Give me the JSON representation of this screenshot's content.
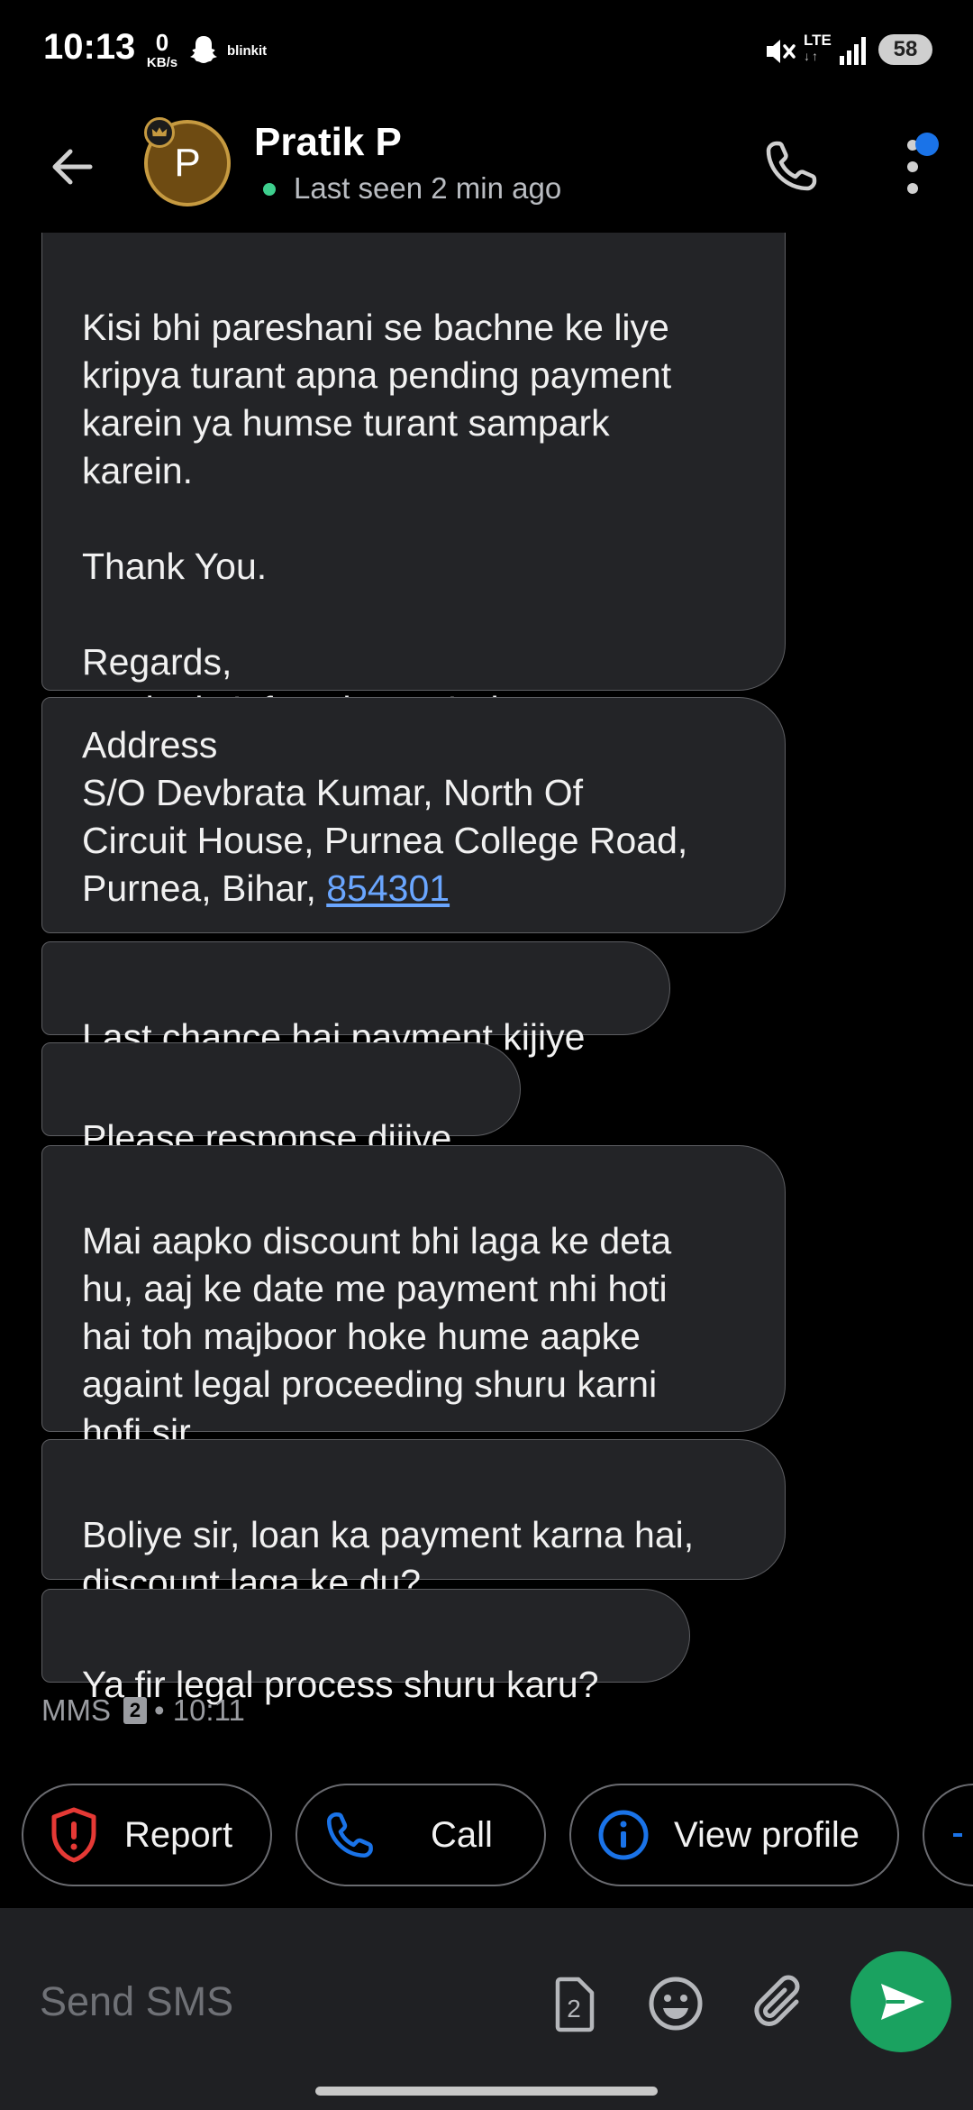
{
  "status_bar": {
    "time": "10:13",
    "net_speed_value": "0",
    "net_speed_unit": "KB/s",
    "notification_app": "blinkit",
    "network": "LTE",
    "battery": "58"
  },
  "header": {
    "avatar_initial": "P",
    "contact_name": "Pratik P",
    "presence": "Last seen 2 min ago"
  },
  "messages": [
    {
      "text": "Kisi bhi pareshani se bachne ke liye\nkripya turant apna pending payment\nkarein ya humse turant sampark\nkarein.\n\nThank You.\n\nRegards,\nPocketly Infotech Pvt. Ltd."
    },
    {
      "text": "Address\nS/O Devbrata Kumar, North Of\nCircuit House, Purnea College Road,\nPurnea, Bihar, ",
      "link": "854301"
    },
    {
      "text": "Last chance hai payment kijiye"
    },
    {
      "text": "Please response dijiye"
    },
    {
      "text": "Mai aapko discount bhi laga ke deta\nhu, aaj ke date me payment nhi hoti\nhai toh majboor hoke hume aapke\nagaint legal proceeding shuru karni\nhofi sir"
    },
    {
      "text": "Boliye sir, loan ka payment karna hai,\ndiscount laga ke du?"
    },
    {
      "text": "Ya fir legal process shuru karu?"
    }
  ],
  "meta": {
    "type": "MMS",
    "sim": "2",
    "time": "• 10:11"
  },
  "chips": [
    {
      "label": "Report",
      "icon": "shield-alert-icon"
    },
    {
      "label": "Call",
      "icon": "phone-icon"
    },
    {
      "label": "View profile",
      "icon": "info-icon"
    }
  ],
  "compose": {
    "placeholder": "Send SMS",
    "sim": "2"
  },
  "colors": {
    "background": "#000000",
    "bubble": "#232427",
    "accent_green": "#1aa260",
    "link_blue": "#6aa6ff",
    "report_red": "#e53935",
    "icon_blue": "#1a73e8"
  }
}
